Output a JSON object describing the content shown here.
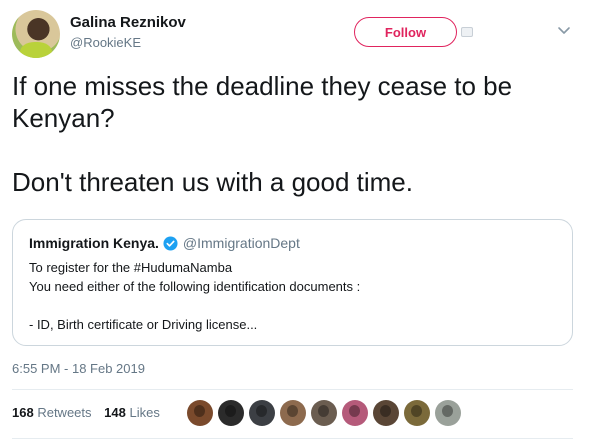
{
  "author": {
    "name": "Galina Reznikov",
    "handle": "@RookieKE",
    "follow_label": "Follow"
  },
  "tweet": {
    "lines": [
      "If one misses the deadline they cease to be",
      "Kenyan?",
      "",
      "Don't threaten us with a good time."
    ]
  },
  "quoted_tweet": {
    "name": "Immigration Kenya.",
    "handle": "@ImmigrationDept",
    "verified": true,
    "lines": [
      "To register for the #HudumaNamba",
      "You need either of the following identification documents :",
      "",
      "- ID, Birth certificate or Driving license..."
    ]
  },
  "timestamp": "6:55 PM - 18 Feb 2019",
  "stats": {
    "retweets_count": "168",
    "retweets_label": "Retweets",
    "likes_count": "148",
    "likes_label": "Likes"
  },
  "likers": [
    {
      "icon": "liker-avatar",
      "color": "#7a4a2c"
    },
    {
      "icon": "liker-avatar",
      "color": "#2b2b2b"
    },
    {
      "icon": "liker-avatar",
      "color": "#3c3f44"
    },
    {
      "icon": "liker-avatar",
      "color": "#8d6a4e"
    },
    {
      "icon": "liker-avatar",
      "color": "#6b5d50"
    },
    {
      "icon": "liker-avatar",
      "color": "#b55a7a"
    },
    {
      "icon": "liker-avatar",
      "color": "#5a4636"
    },
    {
      "icon": "liker-avatar",
      "color": "#7b6a3a"
    },
    {
      "icon": "liker-avatar",
      "color": "#9aa19a"
    }
  ],
  "colors": {
    "follow_accent": "#e0245e",
    "verified_blue": "#1da1f2",
    "secondary_text": "#657786",
    "border": "#ccd6dd"
  },
  "icons": {
    "chevron": "chevron-down-icon",
    "verified": "verified-badge-icon"
  }
}
